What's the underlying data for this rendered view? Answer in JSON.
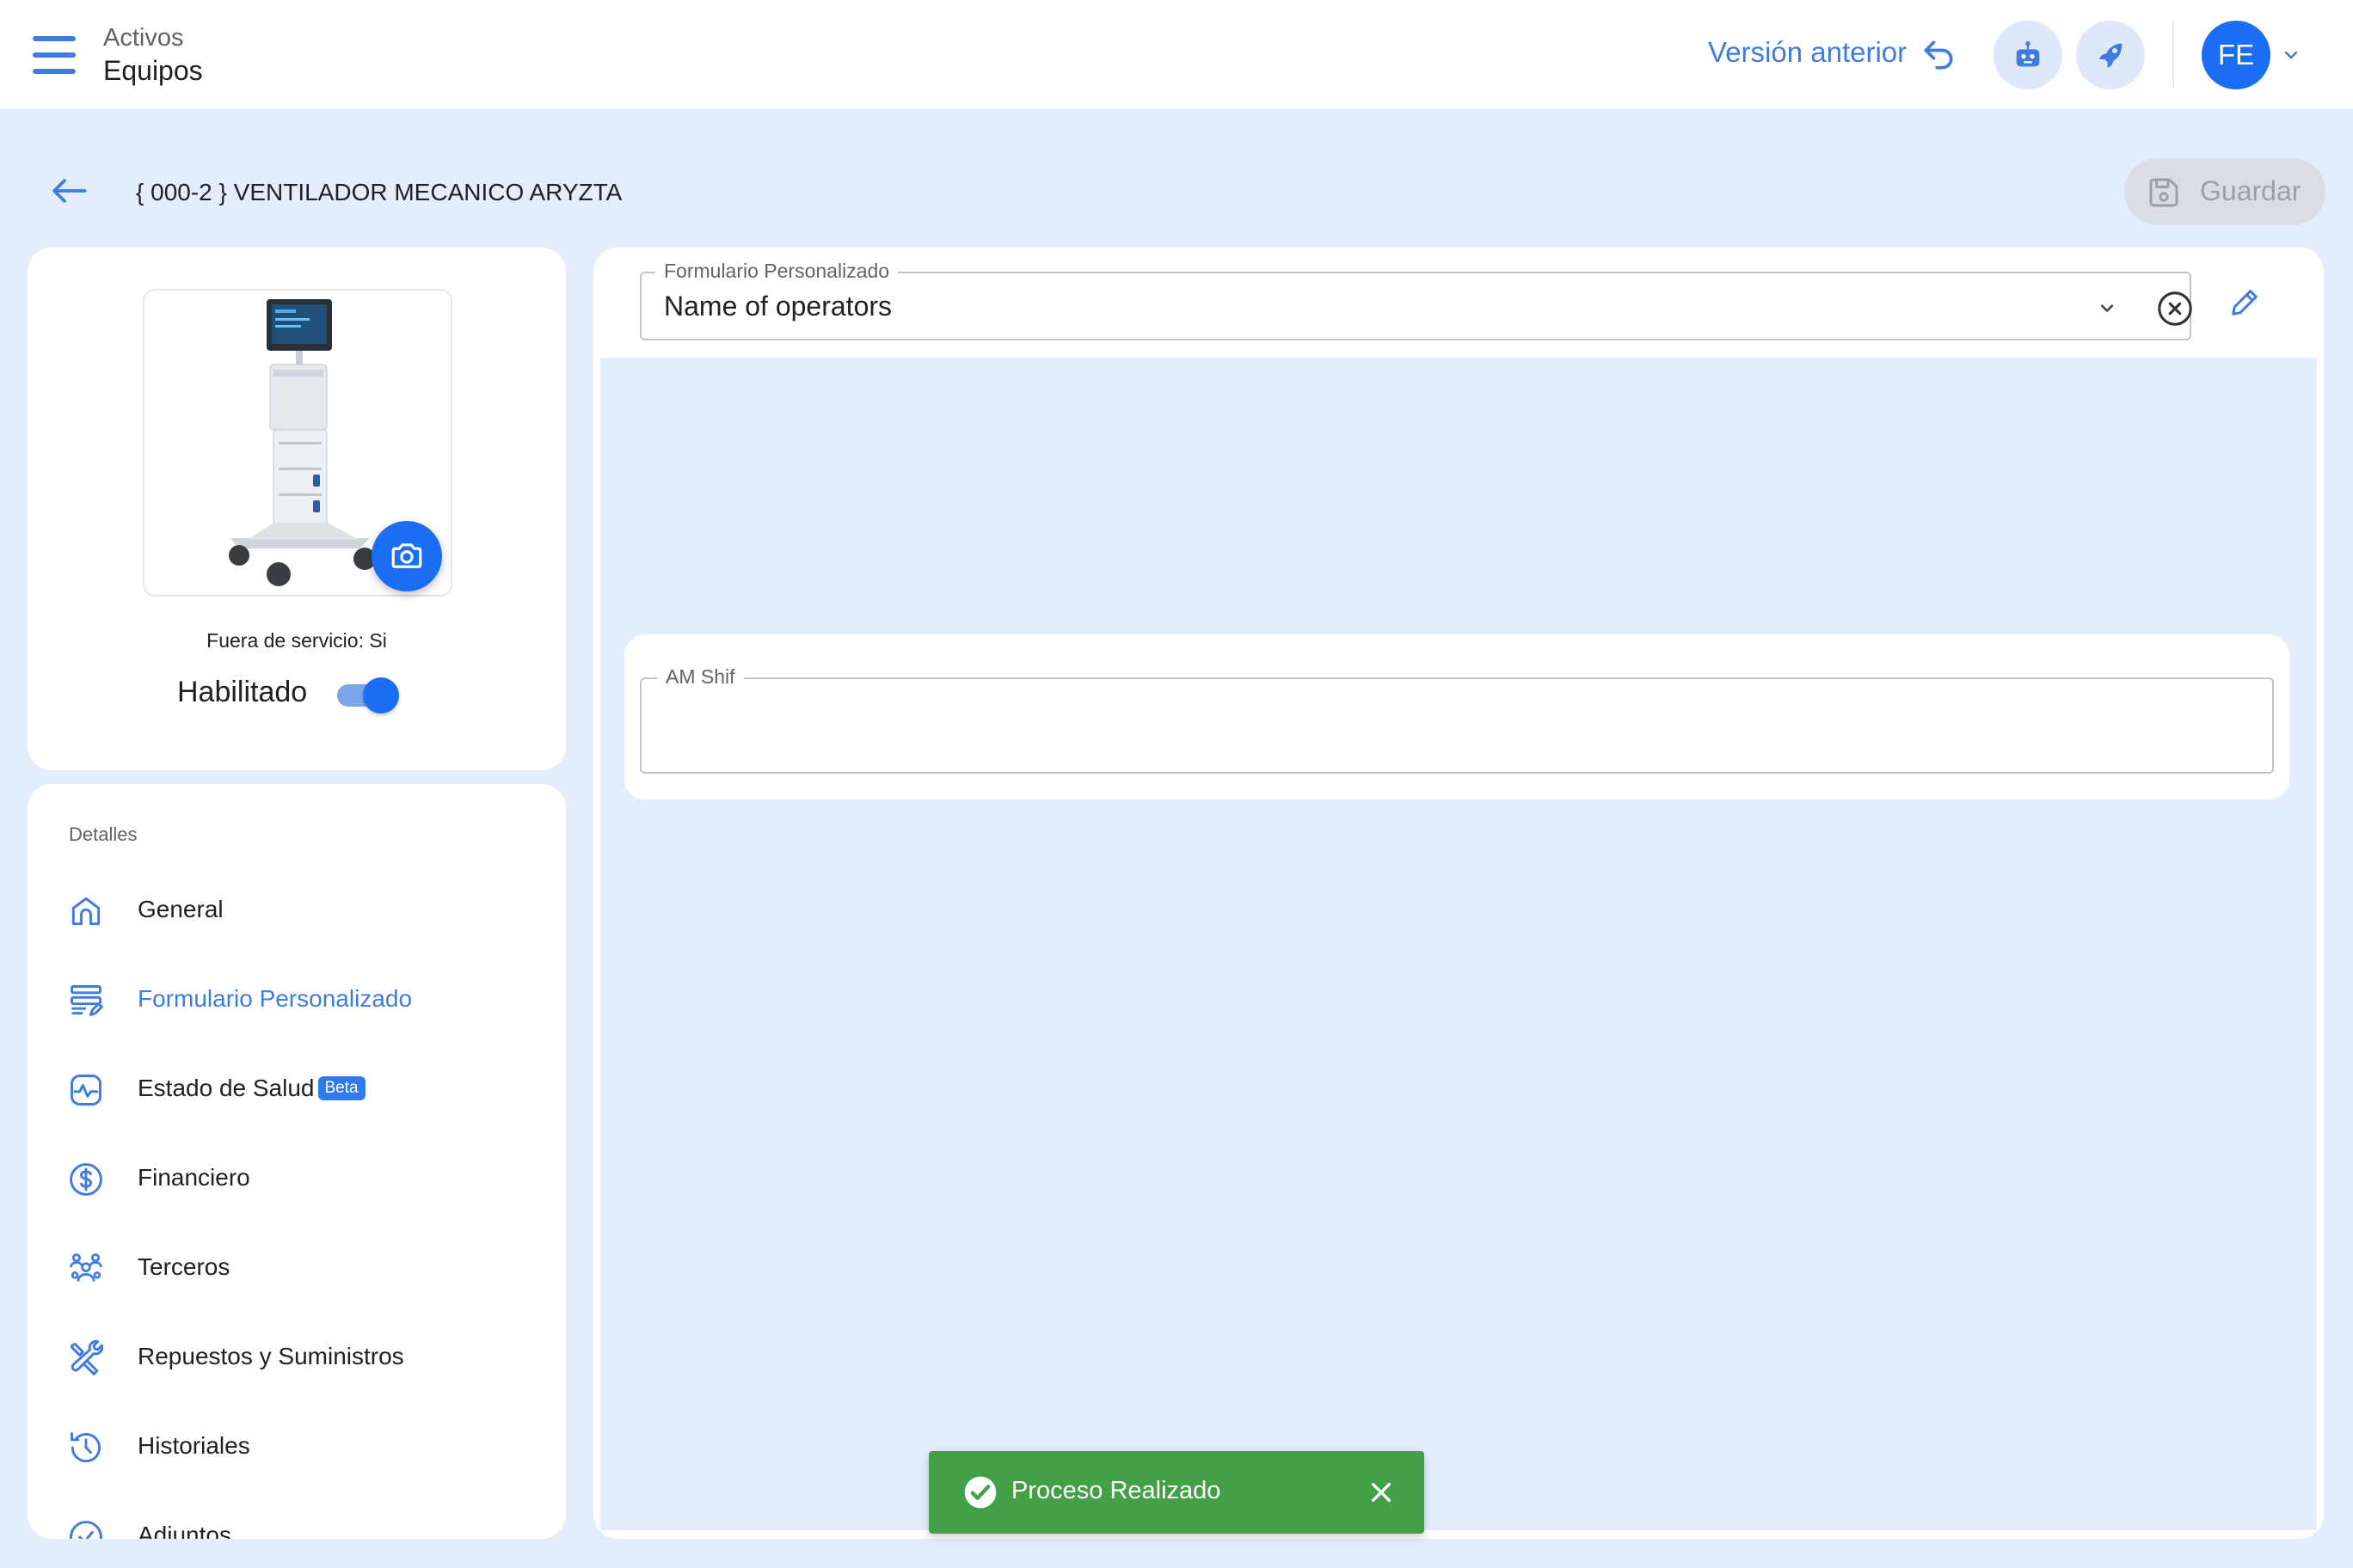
{
  "header": {
    "breadcrumb_top": "Activos",
    "breadcrumb_main": "Equipos",
    "prev_version_label": "Versión anterior",
    "user_initials": "FE"
  },
  "title_bar": {
    "title": "{ 000-2 } VENTILADOR MECANICO ARYZTA",
    "save_label": "Guardar"
  },
  "asset": {
    "out_of_service": "Fuera de servicio: Si",
    "enabled_label": "Habilitado",
    "enabled": true
  },
  "nav": {
    "heading": "Detalles",
    "items": [
      {
        "label": "General",
        "icon": "home-icon"
      },
      {
        "label": "Formulario Personalizado",
        "icon": "form-icon",
        "active": true
      },
      {
        "label": "Estado de Salud",
        "icon": "health-icon",
        "badge": "Beta"
      },
      {
        "label": "Financiero",
        "icon": "dollar-icon"
      },
      {
        "label": "Terceros",
        "icon": "people-icon"
      },
      {
        "label": "Repuestos y Suministros",
        "icon": "tools-icon"
      },
      {
        "label": "Historiales",
        "icon": "history-icon"
      },
      {
        "label": "Adjuntos",
        "icon": "attachment-icon"
      }
    ]
  },
  "form": {
    "select_label": "Formulario Personalizado",
    "select_value": "Name of operators",
    "field_label": "AM Shif",
    "field_value": ""
  },
  "snackbar": {
    "message": "Proceso Realizado"
  },
  "colors": {
    "accent": "#1b6ef3",
    "link": "#3f7be0",
    "success": "#43a047",
    "background": "#e3edfc"
  }
}
